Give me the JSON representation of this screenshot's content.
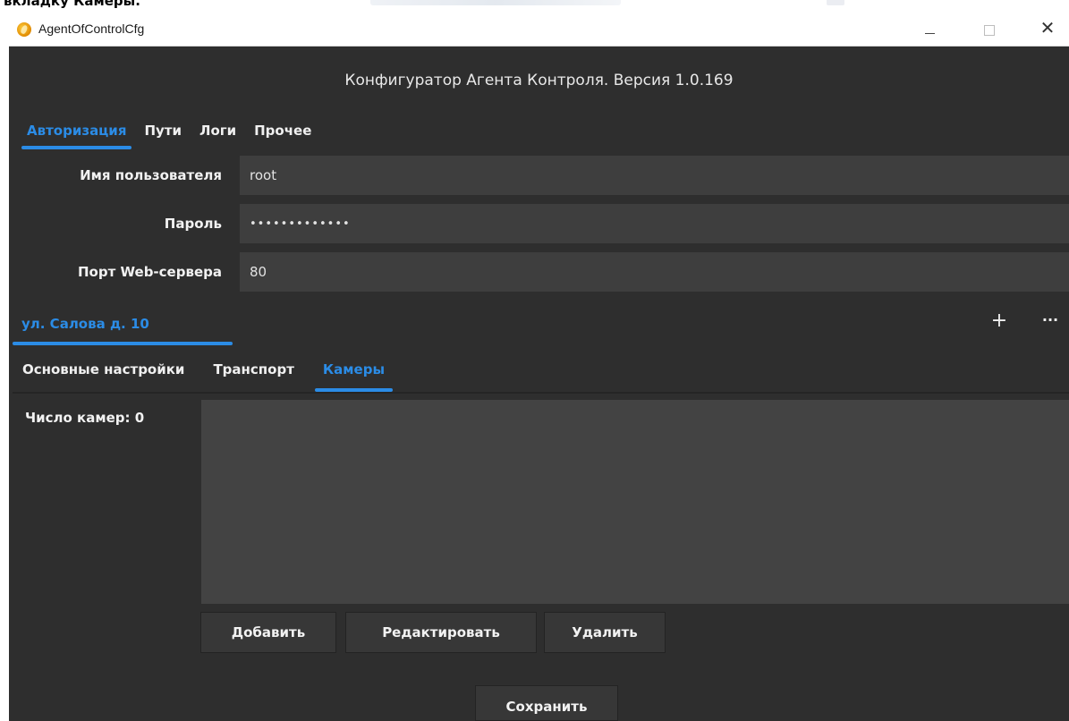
{
  "document": {
    "caption": "вкладку Камеры."
  },
  "window": {
    "title": "AgentOfControlCfg",
    "controls": {
      "minimize": "—",
      "maximize": "☐",
      "close": "✕"
    }
  },
  "header": {
    "title": "Конфигуратор Агента Контроля. Версия 1.0.169"
  },
  "tabs": [
    {
      "label": "Авторизация",
      "active": true
    },
    {
      "label": "Пути",
      "active": false
    },
    {
      "label": "Логи",
      "active": false
    },
    {
      "label": "Прочее",
      "active": false
    }
  ],
  "auth": {
    "username": {
      "label": "Имя пользователя",
      "value": "root"
    },
    "password": {
      "label": "Пароль",
      "value": "•••••••••••••"
    },
    "web_port": {
      "label": "Порт Web-сервера",
      "value": "80"
    }
  },
  "location": {
    "label": "ул. Салова д. 10",
    "add_label": "+",
    "more_label": "···"
  },
  "subtabs": [
    {
      "label": "Основные настройки",
      "active": false
    },
    {
      "label": "Транспорт",
      "active": false
    },
    {
      "label": "Камеры",
      "active": true
    }
  ],
  "cameras": {
    "count_label": "Число камер: 0",
    "items": [],
    "buttons": {
      "add": "Добавить",
      "edit": "Редактировать",
      "delete": "Удалить"
    }
  },
  "footer": {
    "save_label": "Сохранить"
  },
  "colors": {
    "accent": "#2b8ce6",
    "background": "#2e2e2e",
    "input": "#3e3e3e"
  },
  "icons": {
    "app": "agent-app-icon"
  }
}
